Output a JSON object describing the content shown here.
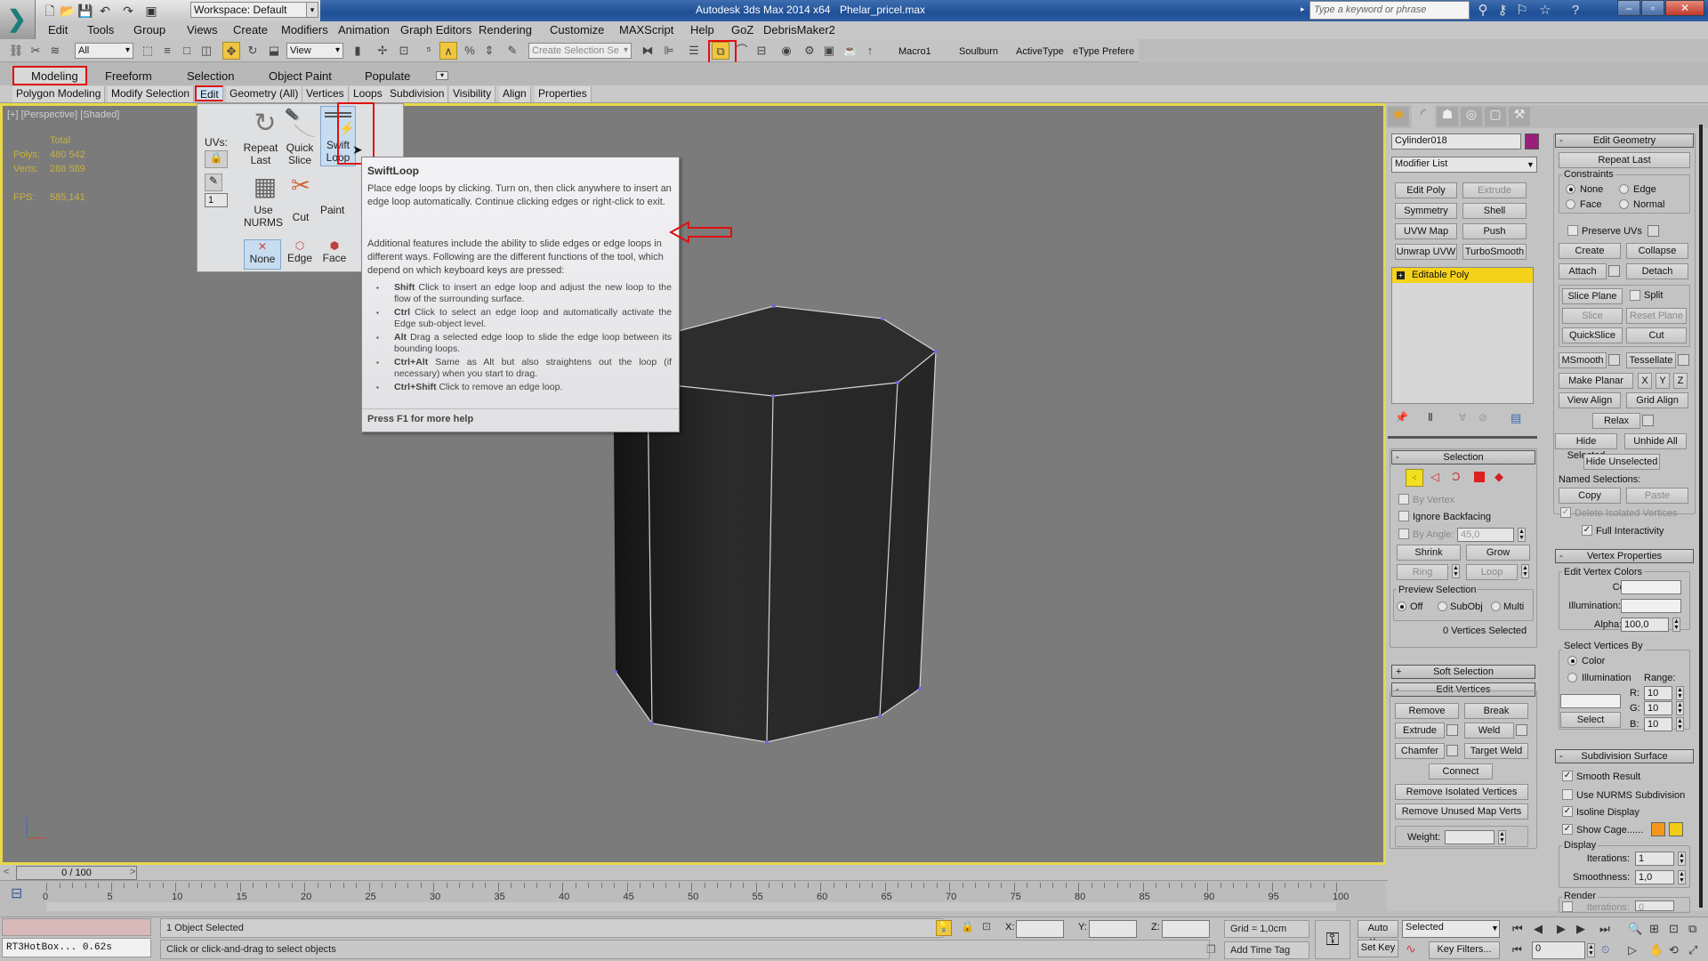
{
  "titlebar": {
    "app_title": "Autodesk 3ds Max 2014 x64",
    "file_name": "Phelar_pricel.max",
    "workspace": "Workspace: Default",
    "search_placeholder": "Type a keyword or phrase"
  },
  "menu": [
    "Edit",
    "Tools",
    "Group",
    "Views",
    "Create",
    "Modifiers",
    "Animation",
    "Graph Editors",
    "Rendering",
    "Customize",
    "MAXScript",
    "Help",
    "GoZ",
    "DebrisMaker2"
  ],
  "toolbar": {
    "selection_filter": "All",
    "reference_coord": "View",
    "named_selection_placeholder": "Create Selection Se",
    "macros": [
      "Macro1",
      "Soulburn",
      "ActiveType",
      "eType Prefere"
    ]
  },
  "ribbon": {
    "tabs": [
      "Modeling",
      "Freeform",
      "Selection",
      "Object Paint",
      "Populate"
    ],
    "active_tab": "Modeling",
    "subtabs": [
      "Polygon Modeling",
      "Modify Selection",
      "Edit",
      "Geometry (All)",
      "Vertices",
      "Loops",
      "Subdivision",
      "Visibility",
      "Align",
      "Properties"
    ],
    "active_subtab": "Edit",
    "edit_panel": {
      "uvs_label": "UVs:",
      "spinner_value": "1",
      "tools": [
        "Repeat Last",
        "Quick Slice",
        "Swift Loop",
        "Use NURMS",
        "Cut",
        "Paint Connect"
      ],
      "constraints": [
        "None",
        "Edge",
        "Face"
      ],
      "active_constraint": "None"
    }
  },
  "viewport": {
    "label": "[+] [Perspective] [Shaded]",
    "stats": {
      "total_label": "Total",
      "polys_label": "Polys:",
      "polys_value": "480 542",
      "verts_label": "Verts:",
      "verts_value": "288 589",
      "fps_label": "FPS:",
      "fps_value": "585,141"
    }
  },
  "tooltip": {
    "title": "SwiftLoop",
    "para1": "Place edge loops by clicking. Turn on, then click anywhere to insert an edge loop automatically. Continue clicking edges or right-click to exit.",
    "para2": "Additional features include the ability to slide edges or edge loops in different ways. Following are the different functions of the tool, which depend on which keyboard keys are pressed:",
    "items": [
      {
        "key": "Shift",
        "text": "Click to insert an edge loop and adjust the new loop to the flow of the surrounding surface."
      },
      {
        "key": "Ctrl",
        "text": "Click to select an edge loop and automatically activate the Edge sub-object level."
      },
      {
        "key": "Alt",
        "text": "Drag a selected edge loop to slide the edge loop between its bounding loops."
      },
      {
        "key": "Ctrl+Alt",
        "text": "Same as Alt but also straightens out the loop (if necessary) when you start to drag."
      },
      {
        "key": "Ctrl+Shift",
        "text": "Click to remove an edge loop."
      }
    ],
    "footer": "Press F1 for more help"
  },
  "command_panel": {
    "object_name": "Cylinder018",
    "object_color": "#9b1f7a",
    "modifier_list": "Modifier List",
    "modifier_buttons": [
      "Edit Poly",
      "Extrude",
      "Symmetry",
      "Shell",
      "UVW Map",
      "Push",
      "Unwrap UVW",
      "TurboSmooth"
    ],
    "stack_item": "Editable Poly",
    "selection": {
      "title": "Selection",
      "by_vertex": "By Vertex",
      "ignore_backfacing": "Ignore Backfacing",
      "by_angle": "By Angle:",
      "angle_value": "45,0",
      "shrink": "Shrink",
      "grow": "Grow",
      "ring": "Ring",
      "loop": "Loop",
      "preview_label": "Preview Selection",
      "preview_options": [
        "Off",
        "SubObj",
        "Multi"
      ],
      "preview_active": "Off",
      "status": "0 Vertices Selected"
    },
    "soft_selection": "Soft Selection",
    "edit_vertices": {
      "title": "Edit Vertices",
      "buttons": [
        "Remove",
        "Break",
        "Extrude",
        "Weld",
        "Chamfer",
        "Target Weld",
        "Connect",
        "Remove Isolated Vertices",
        "Remove Unused Map Verts"
      ],
      "weight_label": "Weight:"
    },
    "edit_geometry": {
      "title": "Edit Geometry",
      "repeat_last": "Repeat Last",
      "constraints_label": "Constraints",
      "constraints": [
        "None",
        "Edge",
        "Face",
        "Normal"
      ],
      "constraint_active": "None",
      "preserve_uvs": "Preserve UVs",
      "create": "Create",
      "collapse": "Collapse",
      "attach": "Attach",
      "detach": "Detach",
      "slice_plane": "Slice Plane",
      "split": "Split",
      "slice": "Slice",
      "reset_plane": "Reset Plane",
      "quickslice": "QuickSlice",
      "cut": "Cut",
      "msmooth": "MSmooth",
      "tessellate": "Tessellate",
      "make_planar": "Make Planar",
      "x": "X",
      "y": "Y",
      "z": "Z",
      "view_align": "View Align",
      "grid_align": "Grid Align",
      "relax": "Relax",
      "hide_selected": "Hide Selected",
      "unhide_all": "Unhide All",
      "hide_unselected": "Hide Unselected",
      "named_selections": "Named Selections:",
      "copy": "Copy",
      "paste": "Paste",
      "delete_isolated": "Delete Isolated Vertices",
      "full_interactivity": "Full Interactivity"
    },
    "vertex_properties": {
      "title": "Vertex Properties",
      "edit_colors": "Edit Vertex Colors",
      "color_label": "Color:",
      "illumination_label": "Illumination:",
      "alpha_label": "Alpha:",
      "alpha_value": "100,0",
      "select_by": "Select Vertices By",
      "select_by_options": [
        "Color",
        "Illumination"
      ],
      "select_by_active": "Color",
      "range_label": "Range:",
      "r_label": "R:",
      "r_value": "10",
      "g_label": "G:",
      "g_value": "10",
      "b_label": "B:",
      "b_value": "10",
      "select_button": "Select"
    },
    "subdivision": {
      "title": "Subdivision Surface",
      "smooth_result": "Smooth Result",
      "use_nurms": "Use NURMS Subdivision",
      "isoline": "Isoline Display",
      "show_cage": "Show Cage......",
      "cage_colors": [
        "#f5961c",
        "#f0cc18"
      ],
      "display_label": "Display",
      "iterations_label": "Iterations:",
      "iterations_value": "1",
      "smoothness_label": "Smoothness:",
      "smoothness_value": "1,0",
      "render_label": "Render",
      "render_iterations_value": "0"
    }
  },
  "timeline": {
    "frame_display": "0 / 100",
    "ticks": [
      0,
      5,
      10,
      15,
      20,
      25,
      30,
      35,
      40,
      45,
      50,
      55,
      60,
      65,
      70,
      75,
      80,
      85,
      90,
      95,
      100
    ]
  },
  "statusbar": {
    "script_output": "RT3HotBox... 0.62s",
    "selection_status": "1 Object Selected",
    "prompt": "Click or click-and-drag to select objects",
    "x_label": "X:",
    "y_label": "Y:",
    "z_label": "Z:",
    "grid": "Grid = 1,0cm",
    "add_time_tag": "Add Time Tag",
    "auto_key": "Auto Key",
    "set_key": "Set Key",
    "key_mode": "Selected",
    "key_filters": "Key Filters...",
    "current_frame": "0"
  }
}
